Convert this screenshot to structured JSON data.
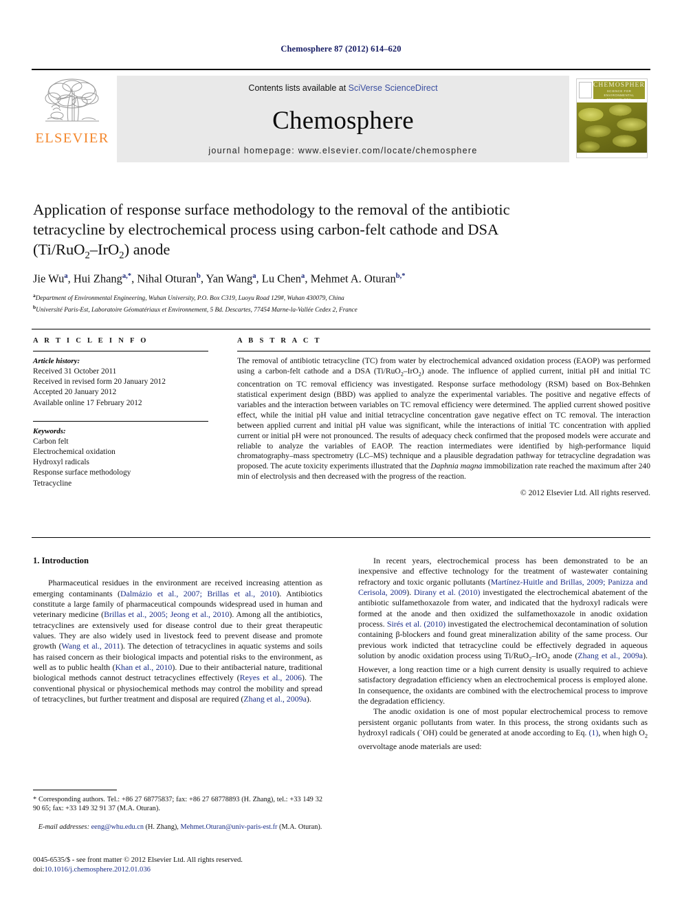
{
  "running_head": "Chemosphere 87 (2012) 614–620",
  "masthead": {
    "publisher_logo_label": "ELSEVIER",
    "contents_prefix": "Contents lists available at ",
    "contents_link": "SciVerse ScienceDirect",
    "journal_name": "Chemosphere",
    "homepage": "journal homepage: www.elsevier.com/locate/chemosphere",
    "cover": {
      "title": "CHEMOSPHERE",
      "subtitle": "SCIENCE FOR ENVIRONMENTAL TECHNOLOGY"
    }
  },
  "article": {
    "title_line1": "Application of response surface methodology to the removal of the antibiotic",
    "title_line2": "tetracycline by electrochemical process using carbon-felt cathode and DSA",
    "title_line3_a": "(Ti/RuO",
    "title_line3_sub1": "2",
    "title_line3_b": "–IrO",
    "title_line3_sub2": "2",
    "title_line3_c": ") anode",
    "authors": [
      {
        "name": "Jie Wu",
        "sup": "a"
      },
      {
        "name": "Hui Zhang",
        "sup": "a,*"
      },
      {
        "name": "Nihal Oturan",
        "sup": "b"
      },
      {
        "name": "Yan Wang",
        "sup": "a"
      },
      {
        "name": "Lu Chen",
        "sup": "a"
      },
      {
        "name": "Mehmet A. Oturan",
        "sup": "b,*"
      }
    ],
    "affiliations": [
      {
        "sup": "a",
        "text": "Department of Environmental Engineering, Wuhan University, P.O. Box C319, Luoyu Road 129#, Wuhan 430079, China"
      },
      {
        "sup": "b",
        "text": "Université Paris-Est, Laboratoire Géomatériaux et Environnement, 5 Bd. Descartes, 77454 Marne-la-Vallée Cedex 2, France"
      }
    ]
  },
  "article_info": {
    "heading": "A R T I C L E   I N F O",
    "history_label": "Article history:",
    "history": [
      "Received 31 October 2011",
      "Received in revised form 20 January 2012",
      "Accepted 20 January 2012",
      "Available online 17 February 2012"
    ],
    "keywords_label": "Keywords:",
    "keywords": [
      "Carbon felt",
      "Electrochemical oxidation",
      "Hydroxyl radicals",
      "Response surface methodology",
      "Tetracycline"
    ]
  },
  "abstract": {
    "heading": "A B S T R A C T",
    "copyright": "© 2012 Elsevier Ltd. All rights reserved."
  },
  "intro": {
    "heading": "1. Introduction",
    "left_para1_end": "",
    "right_para_end": ""
  },
  "footnotes": {
    "corresponding": "* Corresponding authors. Tel.: +86 27 68775837; fax: +86 27 68778893 (H. Zhang), tel.: +33 149 32 90 65; fax: +33 149 32 91 37 (M.A. Oturan).",
    "email_label": "E-mail addresses:",
    "email_1": "eeng@whu.edu.cn",
    "email_1_owner": "(H. Zhang),",
    "email_2": "Mehmet.Oturan@univ-paris-est.fr",
    "email_2_owner": "(M.A. Oturan).",
    "issn_line": "0045-6535/$ - see front matter © 2012 Elsevier Ltd. All rights reserved.",
    "doi_label": "doi:",
    "doi_value": "10.1016/j.chemosphere.2012.01.036"
  },
  "colors": {
    "link_blue": "#1a2d86",
    "elsevier_orange": "#f4872c",
    "running_head_navy": "#151b63",
    "masthead_grey": "#e9e9e9"
  }
}
